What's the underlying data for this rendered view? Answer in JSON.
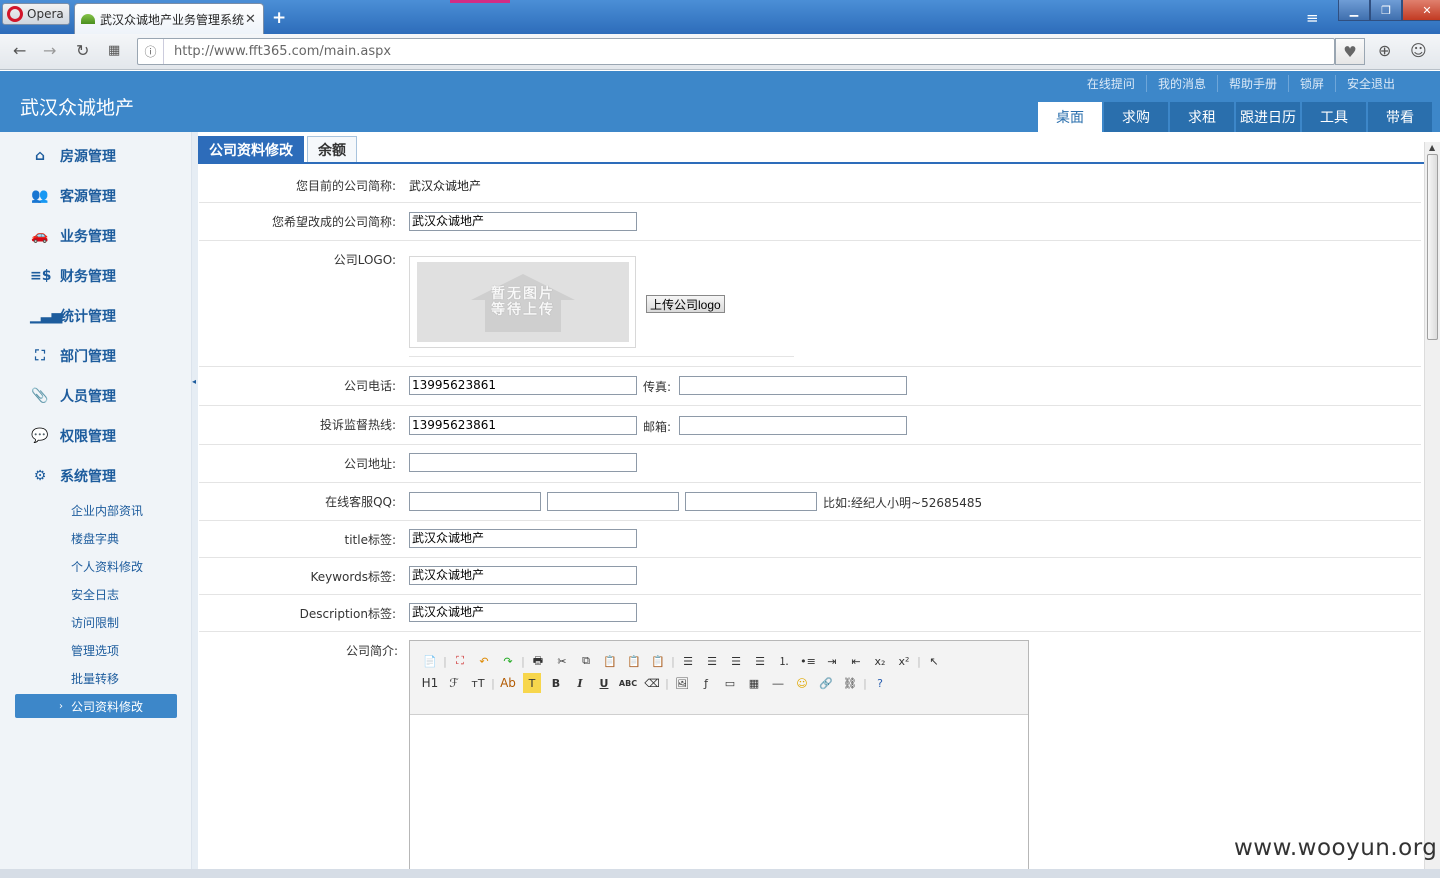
{
  "browser": {
    "menu_label": "Opera",
    "tab_title": "武汉众诚地产业务管理系统",
    "url": "http://www.fft365.com/main.aspx"
  },
  "header": {
    "title": "武汉众诚地产",
    "links": [
      "在线提问",
      "我的消息",
      "帮助手册",
      "锁屏",
      "安全退出"
    ],
    "tabs": [
      "桌面",
      "求购",
      "求租",
      "跟进日历",
      "工具",
      "带看"
    ],
    "active_tab": "桌面"
  },
  "sidebar": {
    "items": [
      {
        "label": "房源管理",
        "icon": "home-icon"
      },
      {
        "label": "客源管理",
        "icon": "users-icon"
      },
      {
        "label": "业务管理",
        "icon": "car-icon"
      },
      {
        "label": "财务管理",
        "icon": "finance-icon"
      },
      {
        "label": "统计管理",
        "icon": "bar-chart-icon"
      },
      {
        "label": "部门管理",
        "icon": "org-chart-icon"
      },
      {
        "label": "人员管理",
        "icon": "paperclip-icon"
      },
      {
        "label": "权限管理",
        "icon": "chat-icon"
      },
      {
        "label": "系统管理",
        "icon": "gear-icon"
      }
    ],
    "sub_items": [
      "企业内部资讯",
      "楼盘字典",
      "个人资料修改",
      "安全日志",
      "访问限制",
      "管理选项",
      "批量转移"
    ],
    "active_sub_item": "公司资料修改"
  },
  "content": {
    "tabs": [
      "公司资料修改",
      "余额"
    ],
    "form": {
      "current_name_label": "您目前的公司简称:",
      "current_name_value": "武汉众诚地产",
      "new_name_label": "您希望改成的公司简称:",
      "new_name_value": "武汉众诚地产",
      "logo_label": "公司LOGO:",
      "logo_placeholder_line1": "暂无图片",
      "logo_placeholder_line2": "等待上传",
      "upload_button": "上传公司logo",
      "phone_label": "公司电话:",
      "phone_value": "13995623861",
      "fax_label": "传真:",
      "fax_value": "",
      "hotline_label": "投诉监督热线:",
      "hotline_value": "13995623861",
      "email_label": "邮箱:",
      "email_value": "",
      "address_label": "公司地址:",
      "address_value": "",
      "qq_label": "在线客服QQ:",
      "qq_values": [
        "",
        "",
        ""
      ],
      "qq_example": "比如:经纪人小明~52685485",
      "title_label": "title标签:",
      "title_value": "武汉众诚地产",
      "keywords_label": "Keywords标签:",
      "keywords_value": "武汉众诚地产",
      "description_label": "Description标签:",
      "description_value": "武汉众诚地产",
      "intro_label": "公司简介:"
    },
    "editor": {
      "heading_button": "H1",
      "font_button": "ℱ",
      "size_button": "тT",
      "color_button": "Ab",
      "bold": "B",
      "italic": "I",
      "underline": "U",
      "strike": "ABC"
    }
  },
  "watermark": "www.wooyun.org"
}
